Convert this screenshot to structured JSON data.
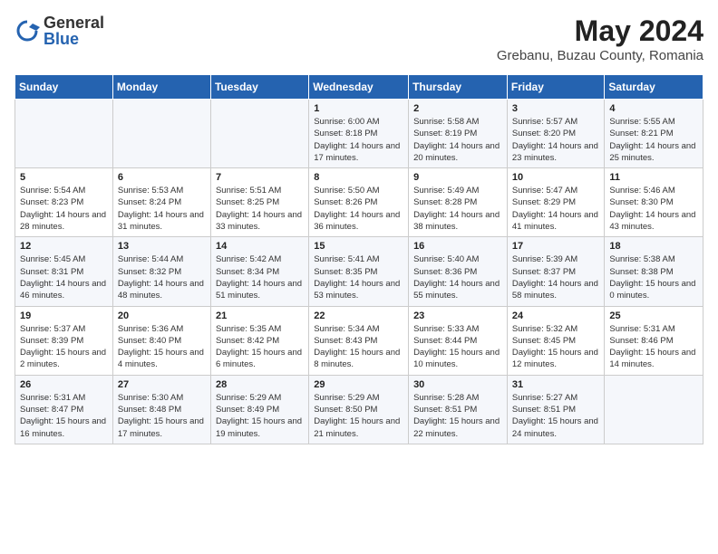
{
  "header": {
    "logo_general": "General",
    "logo_blue": "Blue",
    "month_year": "May 2024",
    "location": "Grebanu, Buzau County, Romania"
  },
  "weekdays": [
    "Sunday",
    "Monday",
    "Tuesday",
    "Wednesday",
    "Thursday",
    "Friday",
    "Saturday"
  ],
  "weeks": [
    [
      {
        "day": "",
        "sunrise": "",
        "sunset": "",
        "daylight": ""
      },
      {
        "day": "",
        "sunrise": "",
        "sunset": "",
        "daylight": ""
      },
      {
        "day": "",
        "sunrise": "",
        "sunset": "",
        "daylight": ""
      },
      {
        "day": "1",
        "sunrise": "Sunrise: 6:00 AM",
        "sunset": "Sunset: 8:18 PM",
        "daylight": "Daylight: 14 hours and 17 minutes."
      },
      {
        "day": "2",
        "sunrise": "Sunrise: 5:58 AM",
        "sunset": "Sunset: 8:19 PM",
        "daylight": "Daylight: 14 hours and 20 minutes."
      },
      {
        "day": "3",
        "sunrise": "Sunrise: 5:57 AM",
        "sunset": "Sunset: 8:20 PM",
        "daylight": "Daylight: 14 hours and 23 minutes."
      },
      {
        "day": "4",
        "sunrise": "Sunrise: 5:55 AM",
        "sunset": "Sunset: 8:21 PM",
        "daylight": "Daylight: 14 hours and 25 minutes."
      }
    ],
    [
      {
        "day": "5",
        "sunrise": "Sunrise: 5:54 AM",
        "sunset": "Sunset: 8:23 PM",
        "daylight": "Daylight: 14 hours and 28 minutes."
      },
      {
        "day": "6",
        "sunrise": "Sunrise: 5:53 AM",
        "sunset": "Sunset: 8:24 PM",
        "daylight": "Daylight: 14 hours and 31 minutes."
      },
      {
        "day": "7",
        "sunrise": "Sunrise: 5:51 AM",
        "sunset": "Sunset: 8:25 PM",
        "daylight": "Daylight: 14 hours and 33 minutes."
      },
      {
        "day": "8",
        "sunrise": "Sunrise: 5:50 AM",
        "sunset": "Sunset: 8:26 PM",
        "daylight": "Daylight: 14 hours and 36 minutes."
      },
      {
        "day": "9",
        "sunrise": "Sunrise: 5:49 AM",
        "sunset": "Sunset: 8:28 PM",
        "daylight": "Daylight: 14 hours and 38 minutes."
      },
      {
        "day": "10",
        "sunrise": "Sunrise: 5:47 AM",
        "sunset": "Sunset: 8:29 PM",
        "daylight": "Daylight: 14 hours and 41 minutes."
      },
      {
        "day": "11",
        "sunrise": "Sunrise: 5:46 AM",
        "sunset": "Sunset: 8:30 PM",
        "daylight": "Daylight: 14 hours and 43 minutes."
      }
    ],
    [
      {
        "day": "12",
        "sunrise": "Sunrise: 5:45 AM",
        "sunset": "Sunset: 8:31 PM",
        "daylight": "Daylight: 14 hours and 46 minutes."
      },
      {
        "day": "13",
        "sunrise": "Sunrise: 5:44 AM",
        "sunset": "Sunset: 8:32 PM",
        "daylight": "Daylight: 14 hours and 48 minutes."
      },
      {
        "day": "14",
        "sunrise": "Sunrise: 5:42 AM",
        "sunset": "Sunset: 8:34 PM",
        "daylight": "Daylight: 14 hours and 51 minutes."
      },
      {
        "day": "15",
        "sunrise": "Sunrise: 5:41 AM",
        "sunset": "Sunset: 8:35 PM",
        "daylight": "Daylight: 14 hours and 53 minutes."
      },
      {
        "day": "16",
        "sunrise": "Sunrise: 5:40 AM",
        "sunset": "Sunset: 8:36 PM",
        "daylight": "Daylight: 14 hours and 55 minutes."
      },
      {
        "day": "17",
        "sunrise": "Sunrise: 5:39 AM",
        "sunset": "Sunset: 8:37 PM",
        "daylight": "Daylight: 14 hours and 58 minutes."
      },
      {
        "day": "18",
        "sunrise": "Sunrise: 5:38 AM",
        "sunset": "Sunset: 8:38 PM",
        "daylight": "Daylight: 15 hours and 0 minutes."
      }
    ],
    [
      {
        "day": "19",
        "sunrise": "Sunrise: 5:37 AM",
        "sunset": "Sunset: 8:39 PM",
        "daylight": "Daylight: 15 hours and 2 minutes."
      },
      {
        "day": "20",
        "sunrise": "Sunrise: 5:36 AM",
        "sunset": "Sunset: 8:40 PM",
        "daylight": "Daylight: 15 hours and 4 minutes."
      },
      {
        "day": "21",
        "sunrise": "Sunrise: 5:35 AM",
        "sunset": "Sunset: 8:42 PM",
        "daylight": "Daylight: 15 hours and 6 minutes."
      },
      {
        "day": "22",
        "sunrise": "Sunrise: 5:34 AM",
        "sunset": "Sunset: 8:43 PM",
        "daylight": "Daylight: 15 hours and 8 minutes."
      },
      {
        "day": "23",
        "sunrise": "Sunrise: 5:33 AM",
        "sunset": "Sunset: 8:44 PM",
        "daylight": "Daylight: 15 hours and 10 minutes."
      },
      {
        "day": "24",
        "sunrise": "Sunrise: 5:32 AM",
        "sunset": "Sunset: 8:45 PM",
        "daylight": "Daylight: 15 hours and 12 minutes."
      },
      {
        "day": "25",
        "sunrise": "Sunrise: 5:31 AM",
        "sunset": "Sunset: 8:46 PM",
        "daylight": "Daylight: 15 hours and 14 minutes."
      }
    ],
    [
      {
        "day": "26",
        "sunrise": "Sunrise: 5:31 AM",
        "sunset": "Sunset: 8:47 PM",
        "daylight": "Daylight: 15 hours and 16 minutes."
      },
      {
        "day": "27",
        "sunrise": "Sunrise: 5:30 AM",
        "sunset": "Sunset: 8:48 PM",
        "daylight": "Daylight: 15 hours and 17 minutes."
      },
      {
        "day": "28",
        "sunrise": "Sunrise: 5:29 AM",
        "sunset": "Sunset: 8:49 PM",
        "daylight": "Daylight: 15 hours and 19 minutes."
      },
      {
        "day": "29",
        "sunrise": "Sunrise: 5:29 AM",
        "sunset": "Sunset: 8:50 PM",
        "daylight": "Daylight: 15 hours and 21 minutes."
      },
      {
        "day": "30",
        "sunrise": "Sunrise: 5:28 AM",
        "sunset": "Sunset: 8:51 PM",
        "daylight": "Daylight: 15 hours and 22 minutes."
      },
      {
        "day": "31",
        "sunrise": "Sunrise: 5:27 AM",
        "sunset": "Sunset: 8:51 PM",
        "daylight": "Daylight: 15 hours and 24 minutes."
      },
      {
        "day": "",
        "sunrise": "",
        "sunset": "",
        "daylight": ""
      }
    ]
  ]
}
